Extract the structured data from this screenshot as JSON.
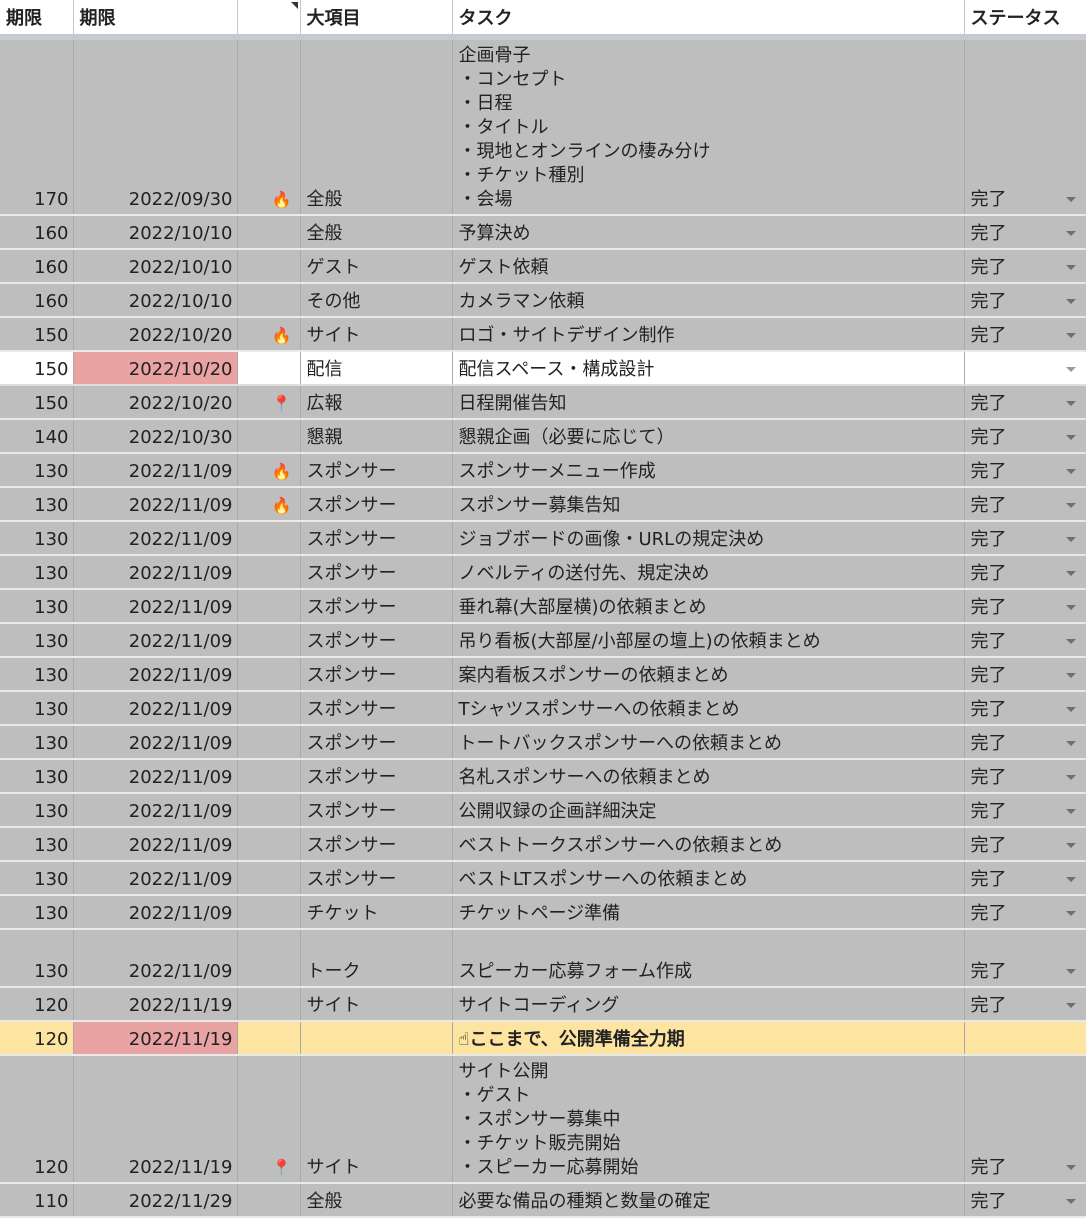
{
  "headers": [
    "期限",
    "期限",
    "",
    "大項目",
    "タスク",
    "ステータス"
  ],
  "icons": {
    "fire": "🔥",
    "pin": "📍",
    "finger": "☝"
  },
  "rows": [
    {
      "num": "170",
      "date": "2022/09/30",
      "icon": "fire",
      "category": "全般",
      "task": "企画骨子\n・コンセプト\n・日程\n・タイトル\n・現地とオンラインの棲み分け\n・チケット種別\n・会場",
      "status": "完了",
      "kind": "tall"
    },
    {
      "num": "160",
      "date": "2022/10/10",
      "icon": "",
      "category": "全般",
      "task": "予算決め",
      "status": "完了"
    },
    {
      "num": "160",
      "date": "2022/10/10",
      "icon": "",
      "category": "ゲスト",
      "task": "ゲスト依頼",
      "status": "完了"
    },
    {
      "num": "160",
      "date": "2022/10/10",
      "icon": "",
      "category": "その他",
      "task": "カメラマン依頼",
      "status": "完了"
    },
    {
      "num": "150",
      "date": "2022/10/20",
      "icon": "fire",
      "category": "サイト",
      "task": "ロゴ・サイトデザイン制作",
      "status": "完了"
    },
    {
      "num": "150",
      "date": "2022/10/20",
      "icon": "",
      "category": "配信",
      "task": "配信スペース・構成設計",
      "status": "",
      "kind": "plain"
    },
    {
      "num": "150",
      "date": "2022/10/20",
      "icon": "pin",
      "category": "広報",
      "task": "日程開催告知",
      "status": "完了"
    },
    {
      "num": "140",
      "date": "2022/10/30",
      "icon": "",
      "category": "懇親",
      "task": "懇親企画（必要に応じて）",
      "status": "完了"
    },
    {
      "num": "130",
      "date": "2022/11/09",
      "icon": "fire",
      "category": "スポンサー",
      "task": "スポンサーメニュー作成",
      "status": "完了"
    },
    {
      "num": "130",
      "date": "2022/11/09",
      "icon": "fire",
      "category": "スポンサー",
      "task": "スポンサー募集告知",
      "status": "完了"
    },
    {
      "num": "130",
      "date": "2022/11/09",
      "icon": "",
      "category": "スポンサー",
      "task": "ジョブボードの画像・URLの規定決め",
      "status": "完了"
    },
    {
      "num": "130",
      "date": "2022/11/09",
      "icon": "",
      "category": "スポンサー",
      "task": "ノベルティの送付先、規定決め",
      "status": "完了"
    },
    {
      "num": "130",
      "date": "2022/11/09",
      "icon": "",
      "category": "スポンサー",
      "task": "垂れ幕(大部屋横)の依頼まとめ",
      "status": "完了"
    },
    {
      "num": "130",
      "date": "2022/11/09",
      "icon": "",
      "category": "スポンサー",
      "task": "吊り看板(大部屋/小部屋の壇上)の依頼まとめ",
      "status": "完了"
    },
    {
      "num": "130",
      "date": "2022/11/09",
      "icon": "",
      "category": "スポンサー",
      "task": "案内看板スポンサーの依頼まとめ",
      "status": "完了"
    },
    {
      "num": "130",
      "date": "2022/11/09",
      "icon": "",
      "category": "スポンサー",
      "task": "Tシャツスポンサーへの依頼まとめ",
      "status": "完了"
    },
    {
      "num": "130",
      "date": "2022/11/09",
      "icon": "",
      "category": "スポンサー",
      "task": "トートバックスポンサーへの依頼まとめ",
      "status": "完了"
    },
    {
      "num": "130",
      "date": "2022/11/09",
      "icon": "",
      "category": "スポンサー",
      "task": "名札スポンサーへの依頼まとめ",
      "status": "完了"
    },
    {
      "num": "130",
      "date": "2022/11/09",
      "icon": "",
      "category": "スポンサー",
      "task": "公開収録の企画詳細決定",
      "status": "完了"
    },
    {
      "num": "130",
      "date": "2022/11/09",
      "icon": "",
      "category": "スポンサー",
      "task": "ベストトークスポンサーへの依頼まとめ",
      "status": "完了"
    },
    {
      "num": "130",
      "date": "2022/11/09",
      "icon": "",
      "category": "スポンサー",
      "task": "ベストLTスポンサーへの依頼まとめ",
      "status": "完了"
    },
    {
      "num": "130",
      "date": "2022/11/09",
      "icon": "",
      "category": "チケット",
      "task": "チケットページ準備",
      "status": "完了"
    },
    {
      "num": "130",
      "date": "2022/11/09",
      "icon": "",
      "category": "トーク",
      "task": "スピーカー応募フォーム作成",
      "status": "完了",
      "kind": "gap"
    },
    {
      "num": "120",
      "date": "2022/11/19",
      "icon": "",
      "category": "サイト",
      "task": "サイトコーディング",
      "status": "完了"
    },
    {
      "num": "120",
      "date": "2022/11/19",
      "icon": "",
      "category": "",
      "task": "☝ここまで、公開準備全力期",
      "status": "",
      "kind": "hl"
    },
    {
      "num": "120",
      "date": "2022/11/19",
      "icon": "pin",
      "category": "サイト",
      "task": "サイト公開\n・ゲスト\n・スポンサー募集中\n・チケット販売開始\n・スピーカー応募開始",
      "status": "完了",
      "kind": "tall2"
    },
    {
      "num": "110",
      "date": "2022/11/29",
      "icon": "",
      "category": "全般",
      "task": "必要な備品の種類と数量の確定",
      "status": "完了"
    }
  ]
}
